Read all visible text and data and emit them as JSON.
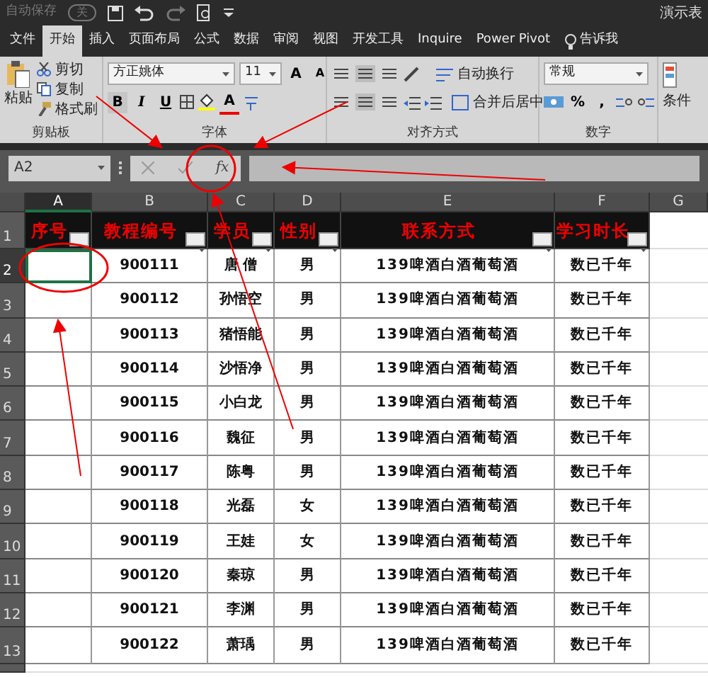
{
  "quick_access": {
    "autosave_label": "自动保存",
    "autosave_state": "关",
    "autosave_on": false
  },
  "title": "演示表",
  "tabs": [
    {
      "label": "文件",
      "selected": false
    },
    {
      "label": "开始",
      "selected": true
    },
    {
      "label": "插入",
      "selected": false
    },
    {
      "label": "页面布局",
      "selected": false
    },
    {
      "label": "公式",
      "selected": false
    },
    {
      "label": "数据",
      "selected": false
    },
    {
      "label": "审阅",
      "selected": false
    },
    {
      "label": "视图",
      "selected": false
    },
    {
      "label": "开发工具",
      "selected": false
    },
    {
      "label": "Inquire",
      "selected": false
    },
    {
      "label": "Power Pivot",
      "selected": false
    }
  ],
  "tell_me": "告诉我",
  "ribbon": {
    "clipboard": {
      "paste": "粘贴",
      "cut": "剪切",
      "copy": "复制",
      "format_painter": "格式刷",
      "group_label": "剪贴板"
    },
    "font": {
      "name": "方正姚体",
      "size": "11",
      "grow": "A",
      "shrink": "A",
      "bold": "B",
      "italic": "I",
      "underline": "U",
      "font_color": "A",
      "group_label": "字体"
    },
    "alignment": {
      "wrap_text": "自动换行",
      "merge_center": "合并后居中",
      "group_label": "对齐方式"
    },
    "number": {
      "format": "常规",
      "percent": "%",
      "comma": ",",
      "group_label": "数字"
    },
    "styles": {
      "conditional": "条件"
    }
  },
  "formula_bar": {
    "name_box": "A2",
    "function_label": "fx"
  },
  "columns": [
    {
      "label": "A",
      "selected": true
    },
    {
      "label": "B",
      "selected": false
    },
    {
      "label": "C",
      "selected": false
    },
    {
      "label": "D",
      "selected": false
    },
    {
      "label": "E",
      "selected": false
    },
    {
      "label": "F",
      "selected": false
    },
    {
      "label": "G",
      "selected": false
    }
  ],
  "header_row": {
    "row_number": "1",
    "cells": [
      "序号",
      "教程编号",
      "学员",
      "性别",
      "联系方式",
      "学习时长"
    ]
  },
  "rows": [
    {
      "row_number": "2",
      "selected": true,
      "id": "900111",
      "name": "唐 僧",
      "gender": "男",
      "contact": "139啤酒白酒葡萄酒",
      "duration": "数已千年"
    },
    {
      "row_number": "3",
      "selected": false,
      "id": "900112",
      "name": "孙悟空",
      "gender": "男",
      "contact": "139啤酒白酒葡萄酒",
      "duration": "数已千年"
    },
    {
      "row_number": "4",
      "selected": false,
      "id": "900113",
      "name": "猪悟能",
      "gender": "男",
      "contact": "139啤酒白酒葡萄酒",
      "duration": "数已千年"
    },
    {
      "row_number": "5",
      "selected": false,
      "id": "900114",
      "name": "沙悟净",
      "gender": "男",
      "contact": "139啤酒白酒葡萄酒",
      "duration": "数已千年"
    },
    {
      "row_number": "6",
      "selected": false,
      "id": "900115",
      "name": "小白龙",
      "gender": "男",
      "contact": "139啤酒白酒葡萄酒",
      "duration": "数已千年"
    },
    {
      "row_number": "7",
      "selected": false,
      "id": "900116",
      "name": "魏征",
      "gender": "男",
      "contact": "139啤酒白酒葡萄酒",
      "duration": "数已千年"
    },
    {
      "row_number": "8",
      "selected": false,
      "id": "900117",
      "name": "陈粤",
      "gender": "男",
      "contact": "139啤酒白酒葡萄酒",
      "duration": "数已千年"
    },
    {
      "row_number": "9",
      "selected": false,
      "id": "900118",
      "name": "光磊",
      "gender": "女",
      "contact": "139啤酒白酒葡萄酒",
      "duration": "数已千年"
    },
    {
      "row_number": "10",
      "selected": false,
      "id": "900119",
      "name": "王娃",
      "gender": "女",
      "contact": "139啤酒白酒葡萄酒",
      "duration": "数已千年"
    },
    {
      "row_number": "11",
      "selected": false,
      "id": "900120",
      "name": "秦琼",
      "gender": "男",
      "contact": "139啤酒白酒葡萄酒",
      "duration": "数已千年"
    },
    {
      "row_number": "12",
      "selected": false,
      "id": "900121",
      "name": "李渊",
      "gender": "男",
      "contact": "139啤酒白酒葡萄酒",
      "duration": "数已千年"
    },
    {
      "row_number": "13",
      "selected": false,
      "id": "900122",
      "name": "萧瑀",
      "gender": "男",
      "contact": "139啤酒白酒葡萄酒",
      "duration": "数已千年"
    }
  ]
}
